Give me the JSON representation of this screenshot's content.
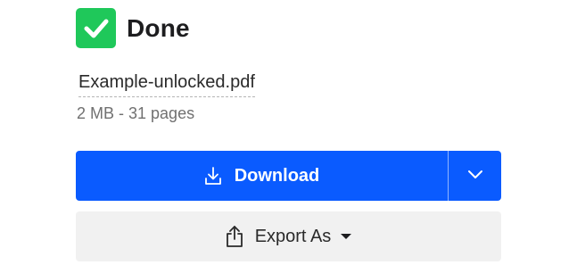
{
  "status": {
    "label": "Done",
    "icon": "check-icon",
    "color": "#1fc85a"
  },
  "file": {
    "name": "Example-unlocked.pdf",
    "meta": "2 MB - 31 pages"
  },
  "actions": {
    "download_label": "Download",
    "download_icon": "download-icon",
    "dropdown_icon": "chevron-down-icon",
    "primary_color": "#0a5bff",
    "export_label": "Export As",
    "export_icon": "share-export-icon",
    "export_caret_icon": "caret-down-icon"
  }
}
